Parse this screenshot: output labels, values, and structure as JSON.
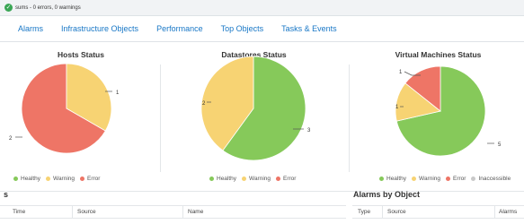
{
  "status": {
    "text": "sums - 0 errors, 0 warnings"
  },
  "tabs": [
    "Alarms",
    "Infrastructure Objects",
    "Performance",
    "Top Objects",
    "Tasks & Events"
  ],
  "colors": {
    "healthy": "#86c95a",
    "warning": "#f7d373",
    "error": "#ee7566",
    "inaccessible": "#c9c9c9",
    "link": "#1877c6"
  },
  "hosts": {
    "title": "Hosts Status",
    "labels": {
      "warning": "1",
      "error": "2"
    },
    "legend": [
      "Healthy",
      "Warning",
      "Error"
    ]
  },
  "datastores": {
    "title": "Datastores Status",
    "labels": {
      "healthy": "3",
      "warning": "2"
    },
    "legend": [
      "Healthy",
      "Warning",
      "Error"
    ]
  },
  "vms": {
    "title": "Virtual Machines Status",
    "labels": {
      "error": "1",
      "warning": "1",
      "healthy": "5"
    },
    "legend": [
      "Healthy",
      "Warning",
      "Error",
      "Inaccessible"
    ]
  },
  "alarms_table": {
    "title_fragment": "s",
    "columns": [
      "Time",
      "Source",
      "Name"
    ]
  },
  "alarms_by_object": {
    "title": "Alarms by Object",
    "columns": [
      "Type",
      "Source",
      "Alarms"
    ]
  },
  "chart_data": [
    {
      "type": "pie",
      "title": "Hosts Status",
      "categories": [
        "Healthy",
        "Warning",
        "Error"
      ],
      "values": [
        0,
        1,
        2
      ]
    },
    {
      "type": "pie",
      "title": "Datastores Status",
      "categories": [
        "Healthy",
        "Warning",
        "Error"
      ],
      "values": [
        3,
        2,
        0
      ]
    },
    {
      "type": "pie",
      "title": "Virtual Machines Status",
      "categories": [
        "Healthy",
        "Warning",
        "Error",
        "Inaccessible"
      ],
      "values": [
        5,
        1,
        1,
        0
      ]
    }
  ]
}
